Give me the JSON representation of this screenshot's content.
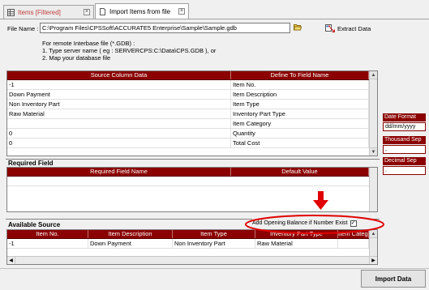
{
  "tabs": [
    {
      "label": "Items [Filtered]",
      "active": false
    },
    {
      "label": "Import Items from file",
      "active": true
    }
  ],
  "file": {
    "label": "File Name :",
    "value": "C:\\Program Files\\CPSSoft\\ACCURATE5 Enterprise\\Sample\\Sample.gdb",
    "extract_label": "Extract Data"
  },
  "hint": {
    "line1": "For remote Interbase file (*.GDB) :",
    "line2": "1. Type server name ( eg : SERVERCPS:C:\\Data\\CPS.GDB ), or",
    "line3": "2. Map your database file"
  },
  "mapping_grid": {
    "columns": [
      "Source Column Data",
      "Define To Field Name"
    ],
    "rows": [
      [
        "-1",
        "Item No."
      ],
      [
        "Down Payment",
        "Item Description"
      ],
      [
        "Non Inventory Part",
        "Item Type"
      ],
      [
        "Raw Material",
        "Inventory Part Type"
      ],
      [
        "",
        "Item Category"
      ],
      [
        "0",
        "Quantity"
      ],
      [
        "0",
        "Total Cost"
      ]
    ]
  },
  "required": {
    "title": "Required Field",
    "columns": [
      "Required Field Name",
      "Default Value"
    ]
  },
  "available": {
    "title": "Available Source",
    "opening_balance_label": "Add Opening Balance if Number Exist",
    "opening_balance_checked": true,
    "columns": [
      "Item No.",
      "Item Description",
      "Item Type",
      "Inventory Part Type",
      "Item Category"
    ],
    "rows": [
      [
        "-1",
        "Down Payment",
        "Non Inventory Part",
        "Raw Material",
        ""
      ]
    ]
  },
  "side": {
    "date_format_label": "Date Format",
    "date_format_value": "dd/mm/yyyy",
    "thousand_sep_label": "Thousand Sep",
    "thousand_sep_value": ",",
    "decimal_sep_label": "Decimal Sep",
    "decimal_sep_value": "."
  },
  "buttons": {
    "import": "Import Data"
  },
  "colors": {
    "grid_header": "#8b0000",
    "annotation": "#e00000"
  }
}
